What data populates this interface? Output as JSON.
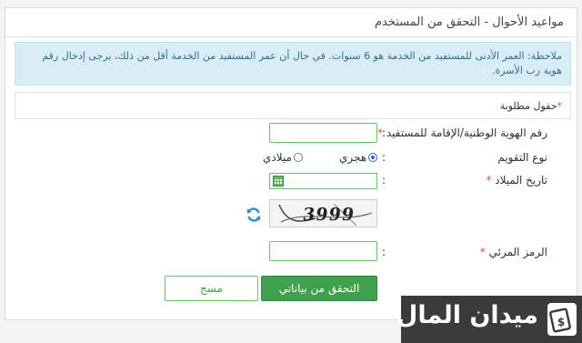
{
  "page": {
    "title": "مواعيد الأحوال - التحقق من المستخدم"
  },
  "note": "ملاحظة: العمر الأدنى للمستفيد من الخدمة هو 6 سنوات. في حال أن عمر المستفيد من الخدمة أقل من ذلك، يرجى إدخال رقم هوية رب الأسرة.",
  "required_note": {
    "star": "*",
    "text": "حقول مطلوبة"
  },
  "form": {
    "id_label": "رقم الهوية الوطنية/الإقامة للمستفيد",
    "id_value": "",
    "calendar_label": "نوع التقويم",
    "calendar_options": [
      {
        "label": "هجري",
        "checked": true
      },
      {
        "label": "ميلادي",
        "checked": false
      }
    ],
    "birthdate_label": "تاريخ الميلاد",
    "birthdate_value": "",
    "captcha_text": "3999",
    "captcha_code_label": "الرمز المرئي",
    "captcha_code_value": "",
    "colon": ":",
    "star": "*"
  },
  "buttons": {
    "submit": "التحقق من بياناتي",
    "clear": "مسح"
  },
  "logo": {
    "text": "ميدان المال"
  },
  "colors": {
    "accent": "#3fa14c",
    "info_bg": "#d9edf7",
    "required": "#d9534f"
  }
}
